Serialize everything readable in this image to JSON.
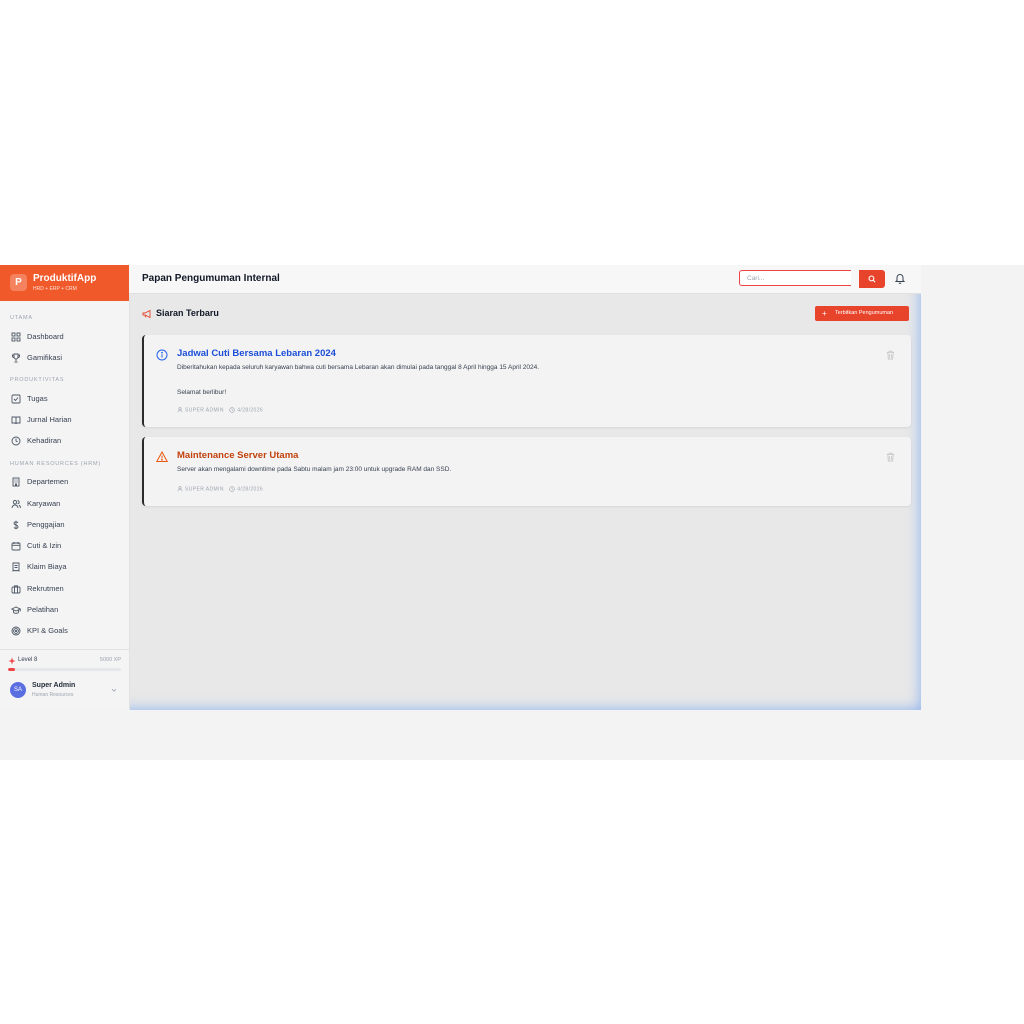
{
  "brand": {
    "logo_letter": "P",
    "name": "ProduktifApp",
    "subtitle": "HRD + ERP + CRM"
  },
  "sidebar": {
    "sections": [
      {
        "label": "UTAMA"
      },
      {
        "label": "PRODUKTIVITAS"
      },
      {
        "label": "HUMAN RESOURCES (HRM)"
      }
    ],
    "items": [
      {
        "label": "Dashboard",
        "icon": "grid-icon"
      },
      {
        "label": "Gamifikasi",
        "icon": "trophy-icon"
      },
      {
        "label": "Tugas",
        "icon": "checkbox-icon"
      },
      {
        "label": "Jurnal Harian",
        "icon": "book-icon"
      },
      {
        "label": "Kehadiran",
        "icon": "clock-icon"
      },
      {
        "label": "Departemen",
        "icon": "building-icon"
      },
      {
        "label": "Karyawan",
        "icon": "users-icon"
      },
      {
        "label": "Penggajian",
        "icon": "dollar-icon"
      },
      {
        "label": "Cuti & Izin",
        "icon": "calendar-icon"
      },
      {
        "label": "Klaim Biaya",
        "icon": "receipt-icon"
      },
      {
        "label": "Rekrutmen",
        "icon": "briefcase-icon"
      },
      {
        "label": "Pelatihan",
        "icon": "graduation-cap-icon"
      },
      {
        "label": "KPI & Goals",
        "icon": "target-icon"
      }
    ],
    "gamification": {
      "level_label": "Level 8",
      "xp_label": "5000 XP",
      "progress": 0.06
    },
    "user": {
      "initials": "SA",
      "name": "Super Admin",
      "role": "Human Resources"
    }
  },
  "header": {
    "title": "Papan Pengumuman Internal",
    "search_placeholder": "Cari..."
  },
  "main": {
    "section_title": "Siaran Terbaru",
    "publish_button": "Terbitkan Pengumuman",
    "announcements": [
      {
        "type": "info",
        "title": "Jadwal Cuti Bersama Lebaran 2024",
        "body": "Diberitahukan kepada seluruh karyawan bahwa cuti bersama Lebaran akan dimulai pada tanggal 8 April hingga 15 April 2024.",
        "body2": "Selamat berlibur!",
        "author": "SUPER ADMIN",
        "date": "4/28/2026"
      },
      {
        "type": "warning",
        "title": "Maintenance Server Utama",
        "body": "Server akan mengalami downtime pada Sabtu malam jam 23:00 untuk upgrade RAM dan SSD.",
        "author": "SUPER ADMIN",
        "date": "4/28/2026"
      }
    ]
  },
  "colors": {
    "accent": "#e8442c",
    "brand": "#f0592a",
    "info_title": "#1d4ed8",
    "warning_title": "#c2410c"
  }
}
